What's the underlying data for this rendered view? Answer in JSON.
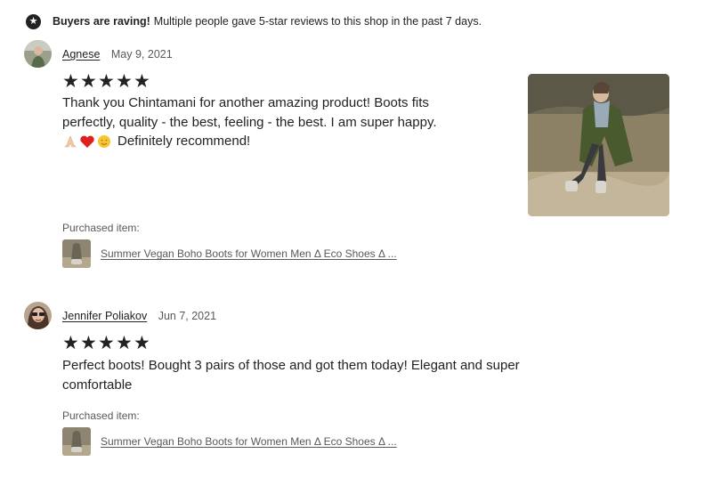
{
  "banner": {
    "icon": "star-badge-icon",
    "bold": "Buyers are raving!",
    "text": "Multiple people gave 5-star reviews to this shop in the past 7 days."
  },
  "reviews": [
    {
      "name": "Agnese",
      "date": "May 9, 2021",
      "rating": 5,
      "line1": "Thank you Chintamani for another amazing product! Boots fits",
      "line2": "perfectly, quality - the best, feeling - the best. I am super happy.",
      "line3": "Definitely recommend!",
      "emojis": [
        "folded-hands-icon",
        "red-heart-icon",
        "smiling-face-icon"
      ],
      "purchased_label": "Purchased item:",
      "item": "Summer Vegan Boho Boots for Women Men Δ Eco Shoes Δ ..."
    },
    {
      "name": "Jennifer Poliakov",
      "date": "Jun 7, 2021",
      "rating": 5,
      "line1": "Perfect boots! Bought 3 pairs of those and got them today! Elegant and super",
      "line2": "comfortable",
      "purchased_label": "Purchased item:",
      "item": "Summer Vegan Boho Boots for Women Men Δ Eco Shoes Δ ..."
    }
  ],
  "colors": {
    "text": "#222222",
    "muted": "#595959",
    "star": "#222222"
  }
}
